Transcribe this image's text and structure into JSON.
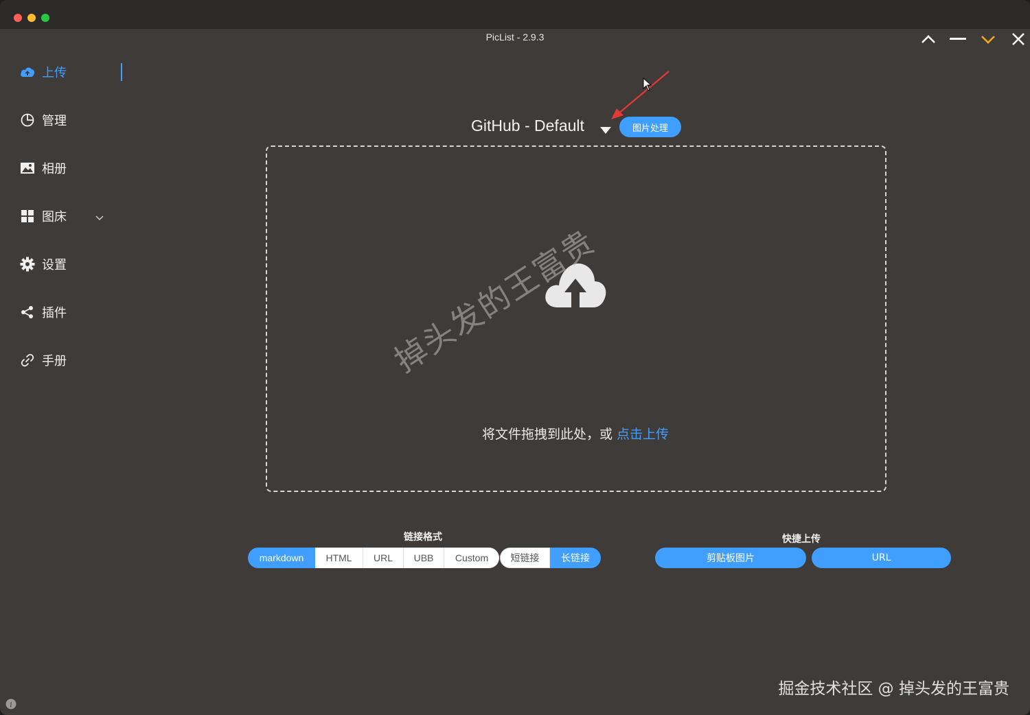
{
  "window": {
    "title": "PicList - 2.9.3"
  },
  "colors": {
    "accent": "#409eff",
    "background": "#3e3b38",
    "arrow": "#e53935",
    "window_ctrl_highlight": "#f5a623"
  },
  "window_controls": [
    {
      "name": "chevron-up-icon"
    },
    {
      "name": "minimize-icon"
    },
    {
      "name": "chevron-down-icon"
    },
    {
      "name": "close-icon"
    }
  ],
  "sidebar": {
    "items": [
      {
        "label": "上传",
        "icon": "cloud-upload-icon",
        "active": true
      },
      {
        "label": "管理",
        "icon": "pie-chart-icon"
      },
      {
        "label": "相册",
        "icon": "image-icon"
      },
      {
        "label": "图床",
        "icon": "grid-icon",
        "expandable": true
      },
      {
        "label": "设置",
        "icon": "gear-icon"
      },
      {
        "label": "插件",
        "icon": "share-icon"
      },
      {
        "label": "手册",
        "icon": "link-icon"
      }
    ]
  },
  "main": {
    "picbed_name": "GitHub - Default",
    "image_process_button": "图片处理",
    "drop_text": "将文件拖拽到此处，或 ",
    "drop_link": "点击上传",
    "watermark": "掉头发的王富贵"
  },
  "link_format": {
    "title": "链接格式",
    "options": [
      "markdown",
      "HTML",
      "URL",
      "UBB",
      "Custom"
    ],
    "selected": "markdown",
    "length_options": [
      "短链接",
      "长链接"
    ],
    "length_selected": "长链接"
  },
  "quick_upload": {
    "title": "快捷上传",
    "buttons": [
      "剪贴板图片",
      "URL"
    ]
  },
  "footer_mark": "掘金技术社区 @ 掉头发的王富贵"
}
